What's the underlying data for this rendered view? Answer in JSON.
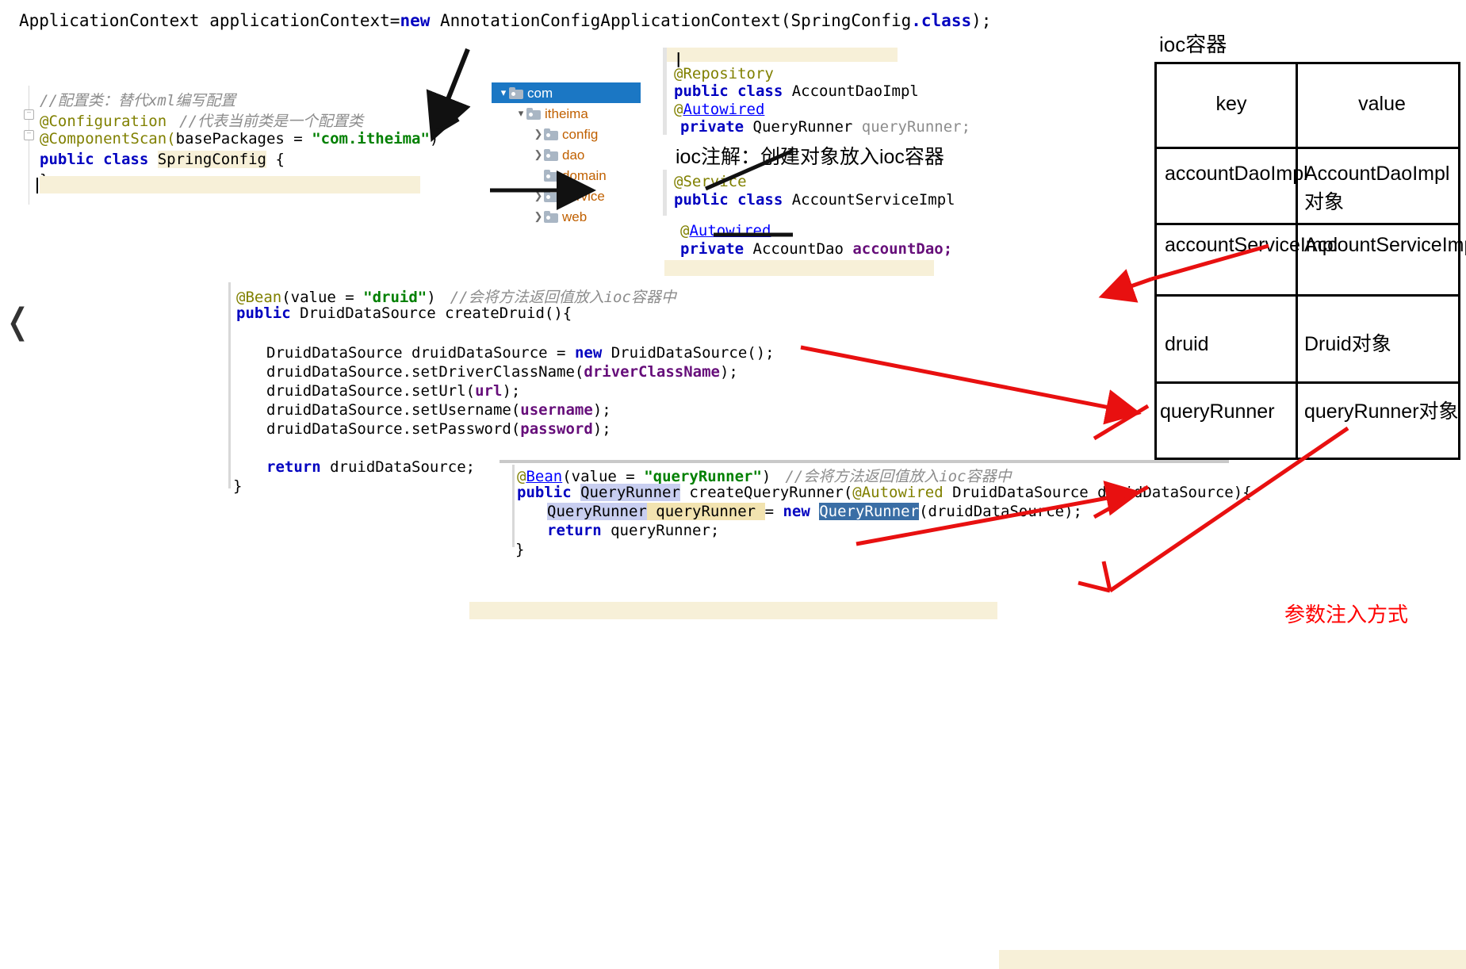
{
  "top_statement": {
    "pre": "ApplicationContext applicationContext=",
    "kw_new": "new",
    "post": " AnnotationConfigApplicationContext(SpringConfig",
    "dot_class": ".class",
    "tail": ");"
  },
  "config_editor": {
    "lines": [
      "//配置类：替代xml编写配置",
      "@Configuration  //代表当前类是一个配置类",
      "@ComponentScan(basePackages = \"com.itheima\")",
      "public class SpringConfig {",
      "}"
    ],
    "l1_comment": "//配置类：替代xml编写配置",
    "l2_ann": "@Configuration",
    "l2_comment": "//代表当前类是一个配置类",
    "l3_ann": "@ComponentScan(",
    "l3_param": "basePackages = ",
    "l3_str": "\"com.itheima\"",
    "l3_end": ")",
    "l4_kw": "public class ",
    "l4_name": "SpringConfig",
    "l4_brace": " {",
    "l5": "}"
  },
  "project_tree": {
    "items": [
      {
        "label": "com",
        "indent": 0,
        "chevron": "down",
        "selected": true
      },
      {
        "label": "itheima",
        "indent": 1,
        "chevron": "down",
        "selected": false
      },
      {
        "label": "config",
        "indent": 2,
        "chevron": "right",
        "selected": false
      },
      {
        "label": "dao",
        "indent": 2,
        "chevron": "right",
        "selected": false
      },
      {
        "label": "domain",
        "indent": 2,
        "chevron": "none",
        "selected": false
      },
      {
        "label": "service",
        "indent": 2,
        "chevron": "right",
        "selected": false
      },
      {
        "label": "web",
        "indent": 2,
        "chevron": "right",
        "selected": false
      }
    ]
  },
  "dao_pane": {
    "ann_repository": "@Repository",
    "class_kw": "public class ",
    "class_name": "AccountDaoImpl",
    "ann_autowired_at": "@",
    "ann_autowired": "Autowired",
    "field_kw": "private ",
    "field_type": "QueryRunner ",
    "field_name": "queryRunner;"
  },
  "ioc_note": "ioc注解：创建对象放入ioc容器",
  "service_pane": {
    "ann_service": "@Service",
    "class_kw": "public class ",
    "class_name": "AccountServiceImpl",
    "ann_autowired_at": "@",
    "ann_autowired": "Autowired",
    "field_kw": "private ",
    "field_type": "AccountDao ",
    "field_name": "accountDao;"
  },
  "druid_pane": {
    "ann_bean": "@Bean",
    "ann_paren_open": "(",
    "ann_value": "value = ",
    "ann_str": "\"druid\"",
    "ann_paren_close": ")",
    "ann_comment": "//会将方法返回值放入ioc容器中",
    "sig_kw": "public ",
    "sig_rest": "DruidDataSource createDruid(){",
    "l_new_a": "DruidDataSource druidDataSource = ",
    "l_new_kw": "new",
    "l_new_b": " DruidDataSource();",
    "l_driver_a": "druidDataSource.setDriverClassName(",
    "l_driver_v": "driverClassName",
    "l_driver_b": ");",
    "l_url_a": "druidDataSource.setUrl(",
    "l_url_v": "url",
    "l_url_b": ");",
    "l_user_a": "druidDataSource.setUsername(",
    "l_user_v": "username",
    "l_user_b": ");",
    "l_pass_a": "druidDataSource.setPassword(",
    "l_pass_v": "password",
    "l_pass_b": ");",
    "l_return_kw": "return",
    "l_return_v": " druidDataSource;",
    "l_close": "}"
  },
  "query_runner_pane": {
    "ann_at": "@",
    "ann_bean": "Bean",
    "ann_paren_open": "(",
    "ann_value": "value = ",
    "ann_str": "\"queryRunner\"",
    "ann_paren_close": ")",
    "ann_comment": "//会将方法返回值放入ioc容器中",
    "sig_kw": "public ",
    "sig_type": "QueryRunner",
    "sig_mid": " createQueryRunner(",
    "sig_ann": "@Autowired",
    "sig_rest": " DruidDataSource druidDataSource){",
    "body_type": "QueryRunner",
    "body_var": " queryRunner ",
    "body_eq": "= ",
    "body_new": "new",
    "body_ctor": "QueryRunner",
    "body_args": "(druidDataSource);",
    "return_kw": "return",
    "return_v": " queryRunner;",
    "close": "}"
  },
  "ioc_container": {
    "title": "ioc容器",
    "headers": {
      "key": "key",
      "value": "value"
    },
    "rows": [
      {
        "key": "accountDaoImpl",
        "value": "AccountDaoImpl对象"
      },
      {
        "key": "accountServiceImpl",
        "value": "AccountServiceImpl对象"
      },
      {
        "key": "druid",
        "value": "Druid对象"
      },
      {
        "key": "queryRunner",
        "value": "queryRunner对象"
      }
    ]
  },
  "red_note": "参数注入方式",
  "back_chevron": "❬",
  "colors": {
    "selection_blue": "#1b77c4",
    "red_arrow": "#ee1111",
    "keyword": "#0000c0",
    "annotation": "#808000",
    "string": "#008000",
    "comment": "#8c8c8c",
    "highlight": "#f7f0d8"
  }
}
